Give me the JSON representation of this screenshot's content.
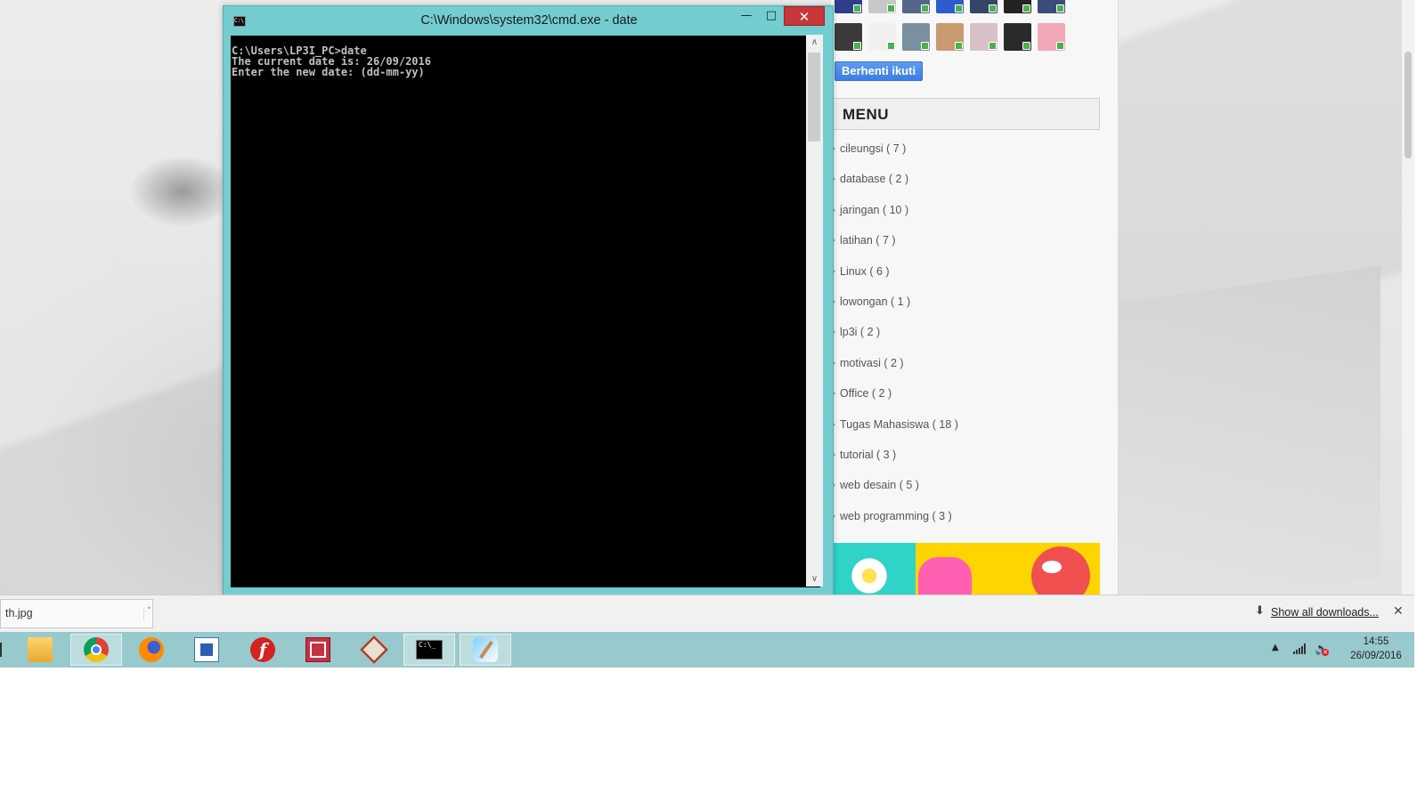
{
  "cmd_window": {
    "title": "C:\\Windows\\system32\\cmd.exe - date",
    "icon": "cmd-icon",
    "icon_text": "C:\\",
    "minimize_glyph": "—",
    "maximize_glyph": "□",
    "close_glyph": "✕",
    "output_lines": [
      "C:\\Users\\LP3I_PC>date",
      "The current date is: 26/09/2016",
      "Enter the new date: (dd-mm-yy)"
    ],
    "scroll_up": "∧",
    "scroll_down": "∨"
  },
  "blog_sidebar": {
    "follow_button_label": "Berhenti ikuti",
    "menu_title": "MENU",
    "menu_items": [
      "cileungsi ( 7 )",
      "database ( 2 )",
      "jaringan ( 10 )",
      "latihan ( 7 )",
      "Linux ( 6 )",
      "lowongan ( 1 )",
      "lp3i ( 2 )",
      "motivasi ( 2 )",
      "Office ( 2 )",
      "Tugas Mahasiswa ( 18 )",
      "tutorial ( 3 )",
      "web desain ( 5 )",
      "web programming ( 3 )"
    ],
    "follower_avatar_colors_row1": [
      "#2d3f8a",
      "#c8c8c8",
      "#556688",
      "#2f5bd0",
      "#35456a",
      "#222222",
      "#3a4d7a"
    ],
    "follower_avatar_colors_row2": [
      "#3a3a3a",
      "#f0f0f0",
      "#7a8fa0",
      "#c99a70",
      "#d8c0c8",
      "#2a2a2a",
      "#f2a8b8"
    ]
  },
  "downloads_bar": {
    "filename": "th.jpg",
    "chevron": "˅",
    "show_all_label": "Show all downloads...",
    "download_icon": "⬇",
    "close_glyph": "✕"
  },
  "taskbar": {
    "apps": [
      {
        "name": "file-explorer-icon",
        "active": false
      },
      {
        "name": "chrome-icon",
        "active": true
      },
      {
        "name": "firefox-icon",
        "active": false
      },
      {
        "name": "document-app-icon",
        "active": false
      },
      {
        "name": "flash-icon",
        "active": false
      },
      {
        "name": "math-app-icon",
        "active": false
      },
      {
        "name": "red-app-icon",
        "active": false
      },
      {
        "name": "cmd-icon",
        "active": true
      },
      {
        "name": "paint-icon",
        "active": true
      }
    ],
    "cmd_icon_text": "C:\\_",
    "flash_glyph": "f",
    "tray_chevron": "▲",
    "volume_glyph": "🔈",
    "volume_mute_glyph": "✕"
  },
  "clock": {
    "time": "14:55",
    "date": "26/09/2016"
  }
}
